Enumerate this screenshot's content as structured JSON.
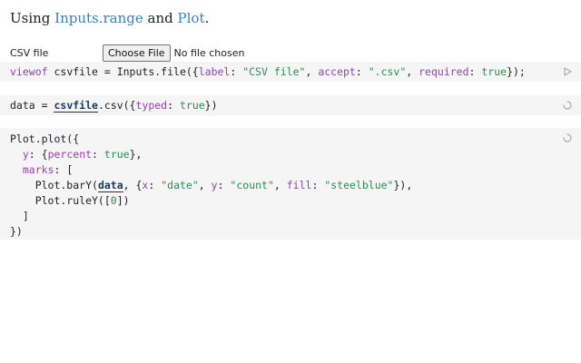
{
  "intro": {
    "prefix": "Using ",
    "link1": "Inputs.range",
    "middle": " and ",
    "link2": "Plot",
    "suffix": "."
  },
  "file_input": {
    "label": "CSV file",
    "button_label": "Choose File",
    "status": "No file chosen"
  },
  "cells": [
    {
      "tokens": [
        "viewof",
        " csvfile = Inputs.file({",
        "label",
        ": ",
        "\"CSV file\"",
        ", ",
        "accept",
        ": ",
        "\".csv\"",
        ", ",
        "required",
        ": ",
        "true",
        "});"
      ],
      "icon": "run-icon"
    },
    {
      "tokens": [
        "data = ",
        "csvfile",
        ".csv({",
        "typed",
        ": ",
        "true",
        "})"
      ],
      "icon": "loading-icon"
    },
    {
      "lines": [
        [
          "Plot.plot({"
        ],
        [
          "  ",
          "y",
          ": {",
          "percent",
          ": ",
          "true",
          "},"
        ],
        [
          "  ",
          "marks",
          ": ["
        ],
        [
          "    Plot.barY(",
          "data",
          ", {",
          "x",
          ": ",
          "\"date\"",
          ", ",
          "y",
          ": ",
          "\"count\"",
          ", ",
          "fill",
          ": ",
          "\"steelblue\"",
          "}),"
        ],
        [
          "    Plot.ruleY([",
          "0",
          "])"
        ],
        [
          "  ]"
        ],
        [
          "})"
        ]
      ],
      "icon": "loading-icon"
    }
  ],
  "colors": {
    "link": "#3b80c2",
    "keyword": "#8e44ad",
    "string": "#2e8b57",
    "cell_background": "#f5f5f5"
  }
}
